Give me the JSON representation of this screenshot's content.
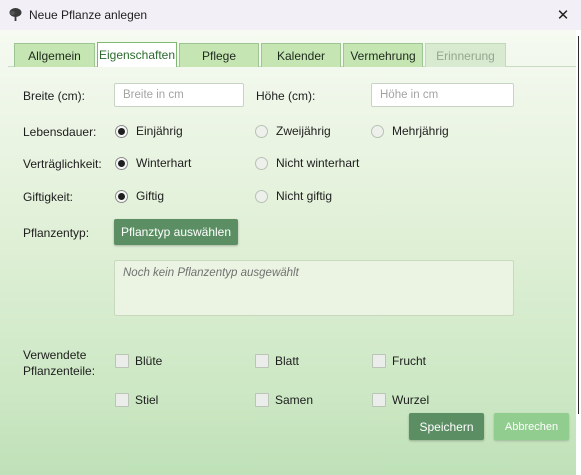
{
  "window": {
    "title": "Neue Pflanze anlegen",
    "app_icon": "tree-icon",
    "close_glyph": "✕"
  },
  "tabs": [
    {
      "label": "Allgemein",
      "state": "normal"
    },
    {
      "label": "Eigenschaften",
      "state": "active"
    },
    {
      "label": "Pflege",
      "state": "normal"
    },
    {
      "label": "Kalender",
      "state": "normal"
    },
    {
      "label": "Vermehrung",
      "state": "normal"
    },
    {
      "label": "Erinnerung",
      "state": "disabled"
    }
  ],
  "form": {
    "width_label": "Breite (cm):",
    "width_placeholder": "Breite in cm",
    "width_value": "",
    "height_label": "Höhe (cm):",
    "height_placeholder": "Höhe in cm",
    "height_value": "",
    "lifespan": {
      "label": "Lebensdauer:",
      "options": [
        "Einjährig",
        "Zweijährig",
        "Mehrjährig"
      ],
      "selected": "Einjährig"
    },
    "tolerance": {
      "label": "Verträglichkeit:",
      "options": [
        "Winterhart",
        "Nicht winterhart"
      ],
      "selected": "Winterhart"
    },
    "toxicity": {
      "label": "Giftigkeit:",
      "options": [
        "Giftig",
        "Nicht giftig"
      ],
      "selected": "Giftig"
    },
    "plant_type": {
      "label": "Pflanzentyp:",
      "button": "Pflanztyp auswählen",
      "empty_text": "Noch kein Pflanzentyp ausgewählt"
    },
    "plant_parts": {
      "label_line1": "Verwendete",
      "label_line2": "Pflanzenteile:",
      "options": [
        "Blüte",
        "Blatt",
        "Frucht",
        "Stiel",
        "Samen",
        "Wurzel"
      ],
      "checked": []
    }
  },
  "actions": {
    "save": "Speichern",
    "cancel": "Abbrechen"
  },
  "colors": {
    "accent_button": "#5b8f63",
    "cancel_button": "#91cd8f",
    "tab_bg": "#c5e6b3",
    "title_bar": "#f3eff6"
  }
}
